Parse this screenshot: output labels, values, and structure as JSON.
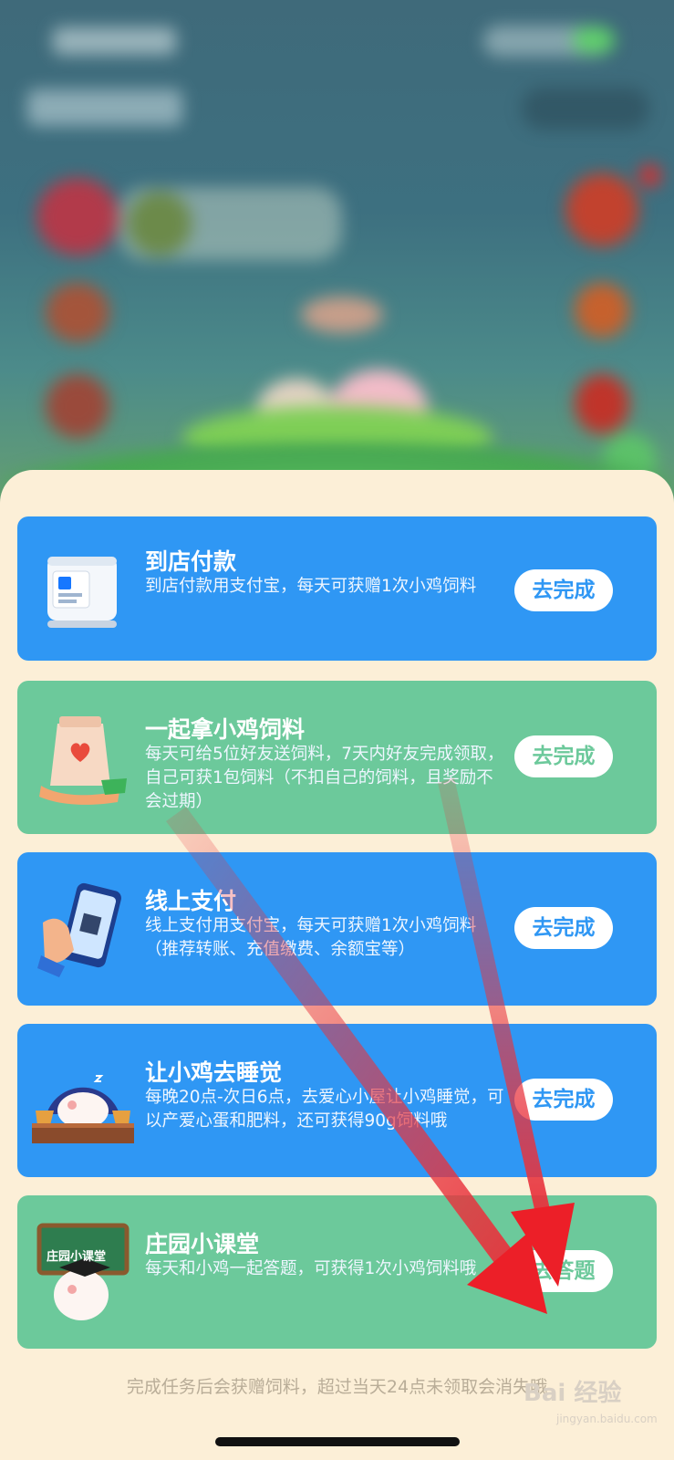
{
  "tasks": [
    {
      "title": "到店付款",
      "desc": "到店付款用支付宝，每天可获赠1次小鸡饲料",
      "button": "去完成",
      "color": "blue",
      "art": "store-scanner-icon"
    },
    {
      "title": "一起拿小鸡饲料",
      "desc": "每天可给5位好友送饲料，7天内好友完成领取，自己可获1包饲料（不扣自己的饲料，且奖励不会过期）",
      "button": "去完成",
      "color": "green",
      "art": "feed-bag-icon"
    },
    {
      "title": "线上支付",
      "desc": "线上支付用支付宝，每天可获赠1次小鸡饲料（推荐转账、充值缴费、余额宝等）",
      "button": "去完成",
      "color": "blue",
      "art": "phone-pay-icon"
    },
    {
      "title": "让小鸡去睡觉",
      "desc": "每晚20点-次日6点，去爱心小屋让小鸡睡觉，可以产爱心蛋和肥料，还可获得90g饲料哦",
      "button": "去完成",
      "color": "blue",
      "art": "sleeping-chick-icon"
    },
    {
      "title": "庄园小课堂",
      "desc": "每天和小鸡一起答题，可获得1次小鸡饲料哦",
      "button": "去答题",
      "color": "green",
      "art": "classroom-chick-icon",
      "art_label": "庄园小课堂"
    }
  ],
  "footer_note": "完成任务后会获赠饲料，超过当天24点未领取会消失哦",
  "watermark": "Bai 经验",
  "watermark_sub": "jingyan.baidu.com"
}
